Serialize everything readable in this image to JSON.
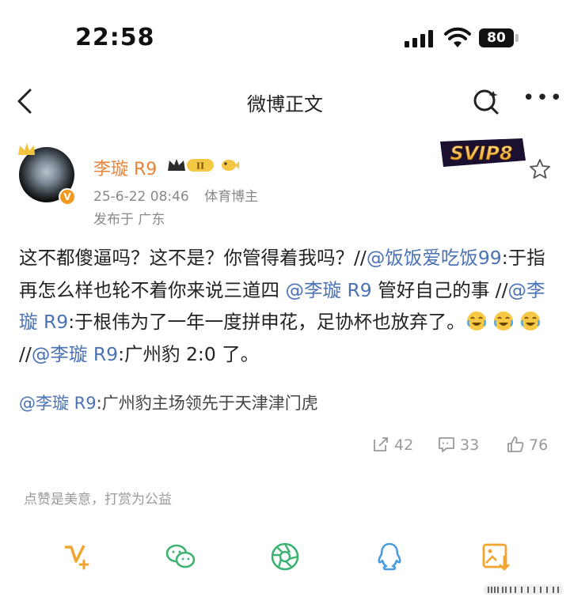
{
  "status_bar": {
    "time": "22:58",
    "battery": "80"
  },
  "nav": {
    "title": "微博正文"
  },
  "author": {
    "name": "李璇 R9",
    "date": "25-6-22 08:46",
    "role": "体育博主",
    "location": "发布于 广东",
    "vip_badge": "SVIP8"
  },
  "post": {
    "segments": [
      {
        "text": "这不都傻逼吗？这不是？你管得着我吗？//",
        "type": "text"
      },
      {
        "text": "@饭饭爱吃饭99",
        "type": "mention"
      },
      {
        "text": ":于指再怎么样也轮不着你来说三道四 ",
        "type": "text"
      },
      {
        "text": "@李璇 R9",
        "type": "mention"
      },
      {
        "text": " 管好自己的事 //",
        "type": "text"
      },
      {
        "text": "@李璇 R9",
        "type": "mention"
      },
      {
        "text": ":于根伟为了一年一度拼申花，足协杯也放弃了。",
        "type": "text"
      },
      {
        "text": "laughing-crying-emoji",
        "type": "emoji"
      },
      {
        "text": "laughing-crying-emoji",
        "type": "emoji"
      },
      {
        "text": "laughing-crying-emoji",
        "type": "emoji"
      },
      {
        "text": "//",
        "type": "text"
      },
      {
        "text": "@李璇 R9",
        "type": "mention"
      },
      {
        "text": ":广州豹 2:0 了。",
        "type": "text"
      }
    ],
    "quoted_mention": "@李璇 R9",
    "quoted_text": ":广州豹主场领先于天津津门虎"
  },
  "actions": {
    "reposts": "42",
    "comments": "33",
    "likes": "76"
  },
  "reward_text": "点赞是美意，打赏为公益",
  "share_bar": [
    "vip-share-icon",
    "wechat-icon",
    "moments-icon",
    "qq-icon",
    "save-image-icon"
  ],
  "colors": {
    "mention": "#4a72b5",
    "username": "#e8833a",
    "share_icon": "#f0a531",
    "wechat": "#3cb371"
  }
}
